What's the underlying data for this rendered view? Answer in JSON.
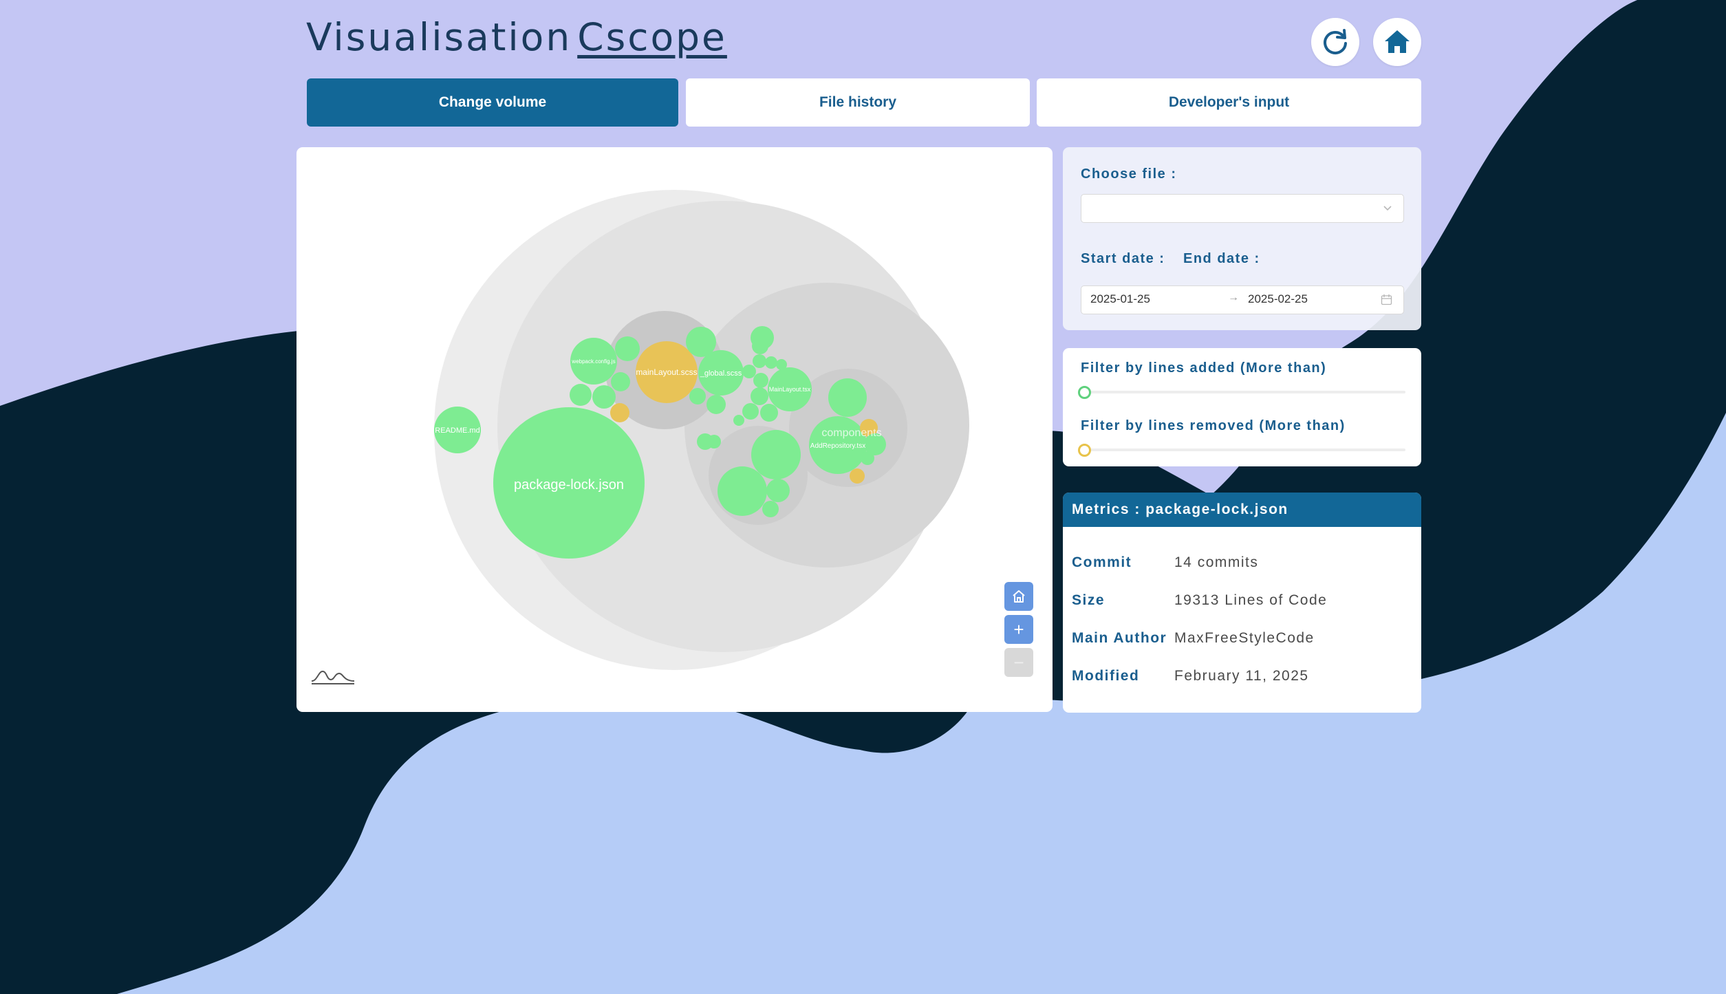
{
  "header": {
    "title_prefix": "Visualisation",
    "title_brand": "Cscope",
    "refresh_icon": "refresh-icon",
    "home_icon": "home-icon"
  },
  "tabs": [
    {
      "label": "Change volume",
      "active": true
    },
    {
      "label": "File history",
      "active": false
    },
    {
      "label": "Developer's input",
      "active": false
    }
  ],
  "filters": {
    "choose_file_label": "Choose file :",
    "choose_file_value": "",
    "start_date_label": "Start date :",
    "end_date_label": "End date :",
    "start_date": "2025-01-25",
    "end_date": "2025-02-25",
    "range_separator": "→"
  },
  "sliders": {
    "lines_added_label": "Filter by lines added (More than)",
    "lines_removed_label": "Filter by lines removed (More than)",
    "lines_added_value": 0,
    "lines_removed_value": 0,
    "added_color": "#5fd17d",
    "removed_color": "#e8c34a"
  },
  "metrics": {
    "title": "Metrics : package-lock.json",
    "rows": [
      {
        "label": "Commit",
        "value": "14 commits"
      },
      {
        "label": "Size",
        "value": "19313 Lines of Code"
      },
      {
        "label": "Main Author",
        "value": "MaxFreeStyleCode"
      },
      {
        "label": "Modified",
        "value": "February 11, 2025"
      }
    ]
  },
  "visualization": {
    "zoom_controls": {
      "home_icon": "home-icon",
      "zoom_in": "+",
      "zoom_out": "−"
    },
    "colors": {
      "added": "#7eec92",
      "modified": "#e8c357",
      "folder_outer": "#ececec",
      "folder_mid": "#e2e2e2",
      "folder_inner": "#d6d6d6"
    },
    "labels": {
      "package_lock": "package-lock.json",
      "readme": "README.md",
      "main_layout_scss": "mainLayout.scss",
      "global_scss": "_global.scss",
      "main_layout_tsx": "MainLayout.tsx",
      "add_repository": "AddRepository.tsx",
      "components": "components",
      "webpack_config": "webpack.config.js"
    }
  }
}
